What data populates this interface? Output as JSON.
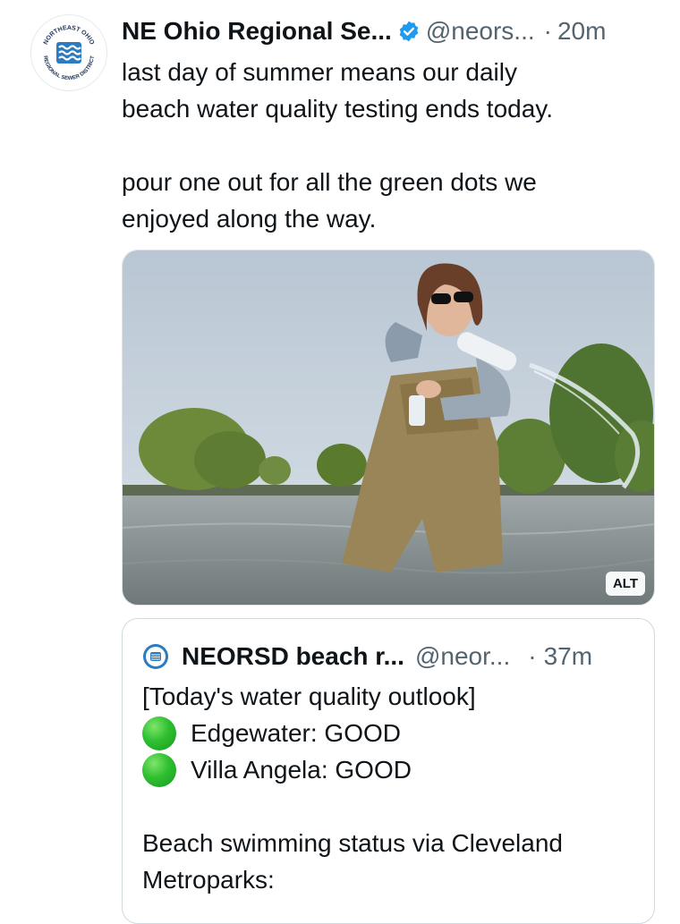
{
  "tweet": {
    "author_name": "NE Ohio Regional Se...",
    "handle": "@neors...",
    "separator": "·",
    "time": "20m",
    "text_line1": "last day of summer means our daily",
    "text_line2": "beach water quality testing ends today.",
    "text_line3": "pour one out for all the green dots we",
    "text_line4": "enjoyed along the way.",
    "avatar": {
      "icon": "neorsd-logo-icon",
      "ring_text_top": "NORTHEAST OHIO",
      "ring_text_bottom": "REGIONAL SEWER DISTRICT"
    },
    "verified_icon": "verified-badge-icon",
    "media": {
      "alt_badge": "ALT"
    }
  },
  "quote": {
    "author_name": "NEORSD beach r...",
    "handle": "@neor...",
    "separator": "·",
    "time": "37m",
    "line1": "[Today's water quality outlook]",
    "status_items": [
      {
        "label": "Edgewater: GOOD",
        "color": "#2fbf31"
      },
      {
        "label": "Villa Angela: GOOD",
        "color": "#2fbf31"
      }
    ],
    "line4": "Beach swimming status via Cleveland",
    "line5": "Metroparks:"
  },
  "colors": {
    "text": "#0f1419",
    "secondary_text": "#536471",
    "verified_blue": "#1d9bf0",
    "good_green": "#2fbf31",
    "border": "#cfd9de"
  }
}
